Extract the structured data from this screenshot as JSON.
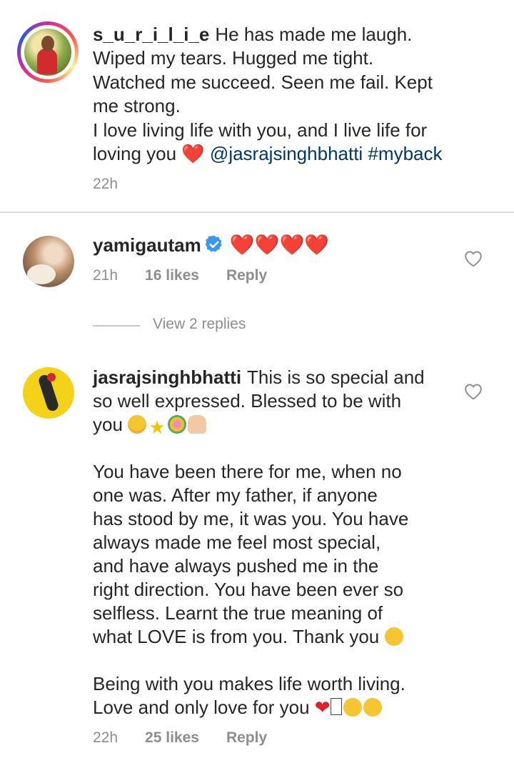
{
  "caption": {
    "username": "s_u_r_i_l_i_e",
    "line1": "He has made me laugh.",
    "line2": "Wiped my tears. Hugged me tight.",
    "line3": "Watched me succeed. Seen me fail. Kept",
    "line4": "me strong.",
    "line5": "I love living life with you, and I live life for",
    "line6_start": "loving you",
    "line6_heart": "❤️",
    "mention": "@jasrajsinghbhatti",
    "hashtag": "#myback",
    "time": "22h"
  },
  "comments": [
    {
      "username": "yamigautam",
      "text": "❤️❤️❤️❤️",
      "time": "21h",
      "likes": "16 likes",
      "reply": "Reply",
      "view_replies": "View 2 replies"
    },
    {
      "username": "jasrajsinghbhatti",
      "line1": "This is so special and",
      "line2": "so well expressed. Blessed to be with",
      "line3": "you",
      "p2_line1": "You have been there for me, when no",
      "p2_line2": "one was. After my father, if anyone",
      "p2_line3": "has stood by me, it was you. You have",
      "p2_line4": "always made me feel most special,",
      "p2_line5": "and have always pushed me in the",
      "p2_line6": "right direction. You have been ever so",
      "p2_line7": "selfless. Learnt the true meaning of",
      "p2_line8": "what LOVE is from you. Thank you",
      "p3_line1": "Being with you makes life worth living.",
      "p3_line2": "Love and only love for you",
      "time": "22h",
      "likes": "25 likes",
      "reply": "Reply"
    }
  ],
  "icons": {
    "like": "heart-outline-icon",
    "verified": "verified-badge-icon"
  },
  "colors": {
    "text": "#262626",
    "meta": "#8e8e8e",
    "mention": "#00376b",
    "verified": "#3897f0",
    "heart": "#e21f26"
  }
}
